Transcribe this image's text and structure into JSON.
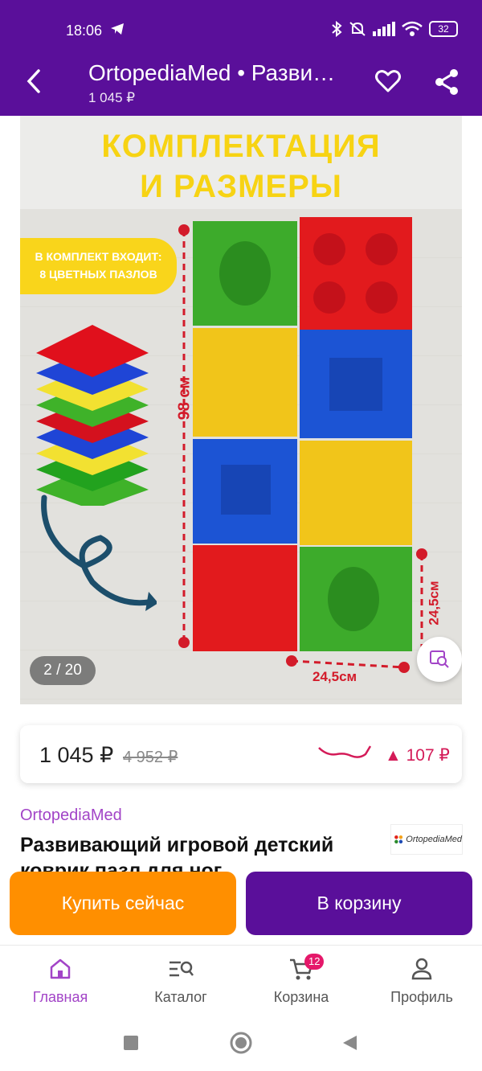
{
  "status_bar": {
    "time": "18:06",
    "battery": "32"
  },
  "header": {
    "title": "OrtopediaMed • Разви…",
    "subtitle": "1 045 ₽"
  },
  "gallery": {
    "image_title_line1": "КОМПЛЕКТАЦИЯ",
    "image_title_line2": "И РАЗМЕРЫ",
    "badge_line1": "В КОМПЛЕКТ ВХОДИТ:",
    "badge_line2": "8 ЦВЕТНЫХ ПАЗЛОВ",
    "dim_height": "98 см",
    "dim_width": "24,5см",
    "dim_side": "24,5см",
    "counter": "2 / 20"
  },
  "price_card": {
    "price": "1 045 ₽",
    "old_price": "4 952 ₽",
    "delta": "▲ 107 ₽"
  },
  "product": {
    "seller": "OrtopediaMed",
    "title": "Развивающий игровой детский коврик пазл для ног",
    "logo_text": "OrtopediaMed"
  },
  "actions": {
    "buy_now": "Купить сейчас",
    "add_to_cart": "В корзину"
  },
  "bottom_nav": {
    "home": "Главная",
    "catalog": "Каталог",
    "cart": "Корзина",
    "cart_count": "12",
    "profile": "Профиль"
  },
  "colors": {
    "brand": "#5a0f9a",
    "accent_orange": "#ff8f00",
    "accent_pink": "#d41b58",
    "seller": "#a244c7"
  }
}
